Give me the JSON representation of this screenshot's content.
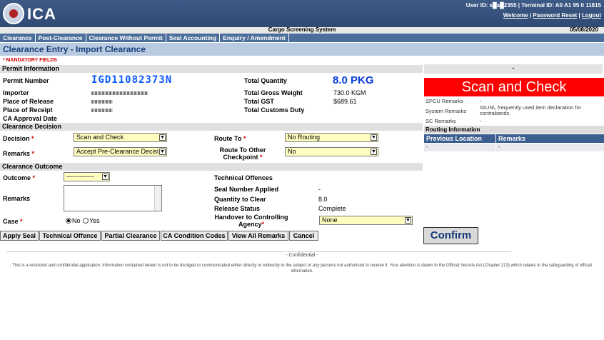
{
  "header": {
    "app_name": "ICA",
    "user_info": "User ID: s█a█2355 | Terminal ID: A0 A1 95 0 11815",
    "links": [
      "Welcome",
      "Password Reset",
      "Logout"
    ],
    "system_title": "Cargo Screening System",
    "date": "05/08/2020"
  },
  "nav": [
    "Clearance",
    "Post-Clearance",
    "Clearance Without Permit",
    "Seal Accounting",
    "Enquiry / Amendment"
  ],
  "page_title": "Clearance Entry - Import Clearance",
  "mandatory_note": "* MANDATORY FIELDS",
  "permit": {
    "section_title": "Permit Information",
    "permit_number_label": "Permit Number",
    "permit_number": "IGD11082373N",
    "importer_label": "Importer",
    "place_release_label": "Place of Release",
    "place_receipt_label": "Place of Receipt",
    "ca_approval_label": "CA Approval Date",
    "total_qty_label": "Total Quantity",
    "total_qty": "8.0 PKG",
    "gross_weight_label": "Total Gross Weight",
    "gross_weight": "730.0 KGM",
    "gst_label": "Total GST",
    "gst": "$689.61",
    "customs_duty_label": "Total Customs Duty"
  },
  "decision": {
    "section_title": "Clearance Decision",
    "decision_label": "Decision",
    "decision_value": "Scan and Check",
    "remarks_label": "Remarks",
    "remarks_value": "Accept Pre-Clearance Decisi",
    "route_to_label": "Route To",
    "route_to_value": "No Routing",
    "route_other_label": "Route To Other Checkpoint",
    "route_other_value": "No"
  },
  "outcome": {
    "section_title": "Clearance Outcome",
    "outcome_label": "Outcome",
    "outcome_value": "-------------",
    "remarks_label": "Remarks",
    "case_label": "Case",
    "case_no": "No",
    "case_yes": "Yes",
    "tech_offences_label": "Technical Offences",
    "seal_label": "Seal Number Applied",
    "seal_value": "-",
    "qty_clear_label": "Quantity to Clear",
    "qty_clear_value": "8.0",
    "release_status_label": "Release Status",
    "release_status_value": "Complete",
    "handover_label": "Handover to Controlling Agency",
    "handover_value": "None"
  },
  "buttons": [
    "Apply Seal",
    "Technical Offence",
    "Partial Clearance",
    "CA Condition Codes",
    "View All Remarks",
    "Cancel"
  ],
  "right_panel": {
    "header": "-",
    "scan_text": "Scan and Check",
    "spcu_label": "SPCU Remarks",
    "spcu_value": "-",
    "system_label": "System Remarks",
    "system_value": "\\GUN\\, frequently used item declaration for contrabands.",
    "sc_label": "SC Remarks",
    "sc_value": "-",
    "routing_title": "Routing Information",
    "routing_cols": [
      "Previous Location",
      "Remarks"
    ],
    "routing_row": [
      "-",
      "-"
    ],
    "confirm": "Confirm"
  },
  "footer": {
    "confidential": "- Confidential -",
    "legal": "This is a restricted and confidential application. Information contained herein is not to be divulged or communicated either directly or indirectly to the subject or any persons not authorised to receive it. Your attention is drawn to the Official Secrets Act (Chapter 213) which relates to the safeguarding of official information."
  }
}
